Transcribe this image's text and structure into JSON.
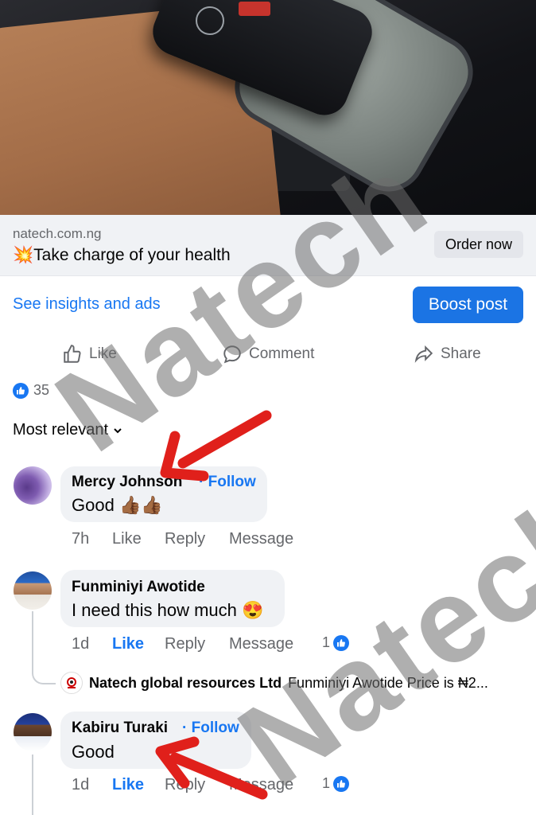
{
  "ad": {
    "domain": "natech.com.ng",
    "headline_emoji": "💥",
    "headline": "Take charge of your health",
    "order_label": "Order now"
  },
  "promo": {
    "insights_label": "See insights and ads",
    "boost_label": "Boost post"
  },
  "actions": {
    "like": "Like",
    "comment": "Comment",
    "share": "Share"
  },
  "reactions": {
    "count": "35"
  },
  "sort": {
    "label": "Most relevant"
  },
  "comments": [
    {
      "name": "Mercy Johnson",
      "follow": "· Follow",
      "text": "Good",
      "emoji": "👍🏾👍🏾",
      "time": "7h",
      "like": "Like",
      "reply": "Reply",
      "message": "Message"
    },
    {
      "name": "Funminiyi Awotide",
      "text": "I need this how much",
      "emoji": "😍",
      "time": "1d",
      "like": "Like",
      "reply": "Reply",
      "message": "Message",
      "reactions": "1"
    },
    {
      "name": "Kabiru Turaki",
      "follow": "· Follow",
      "text": "Good",
      "time": "1d",
      "like": "Like",
      "reply": "Reply",
      "message": "Message",
      "reactions": "1"
    }
  ],
  "reply": {
    "name": "Natech global resources Ltd",
    "text": "Funminiyi Awotide Price is ₦2..."
  },
  "watermark": {
    "text1": "Natech",
    "text2": "Natech"
  },
  "colors": {
    "accent": "#1877f2",
    "arrow": "#e0201b",
    "muted": "#65676b",
    "bubble": "#f0f2f5"
  },
  "icons": [
    "like-icon",
    "comment-icon",
    "share-icon",
    "chevron-down-icon",
    "thumbs-up-badge-icon",
    "red-arrow"
  ]
}
